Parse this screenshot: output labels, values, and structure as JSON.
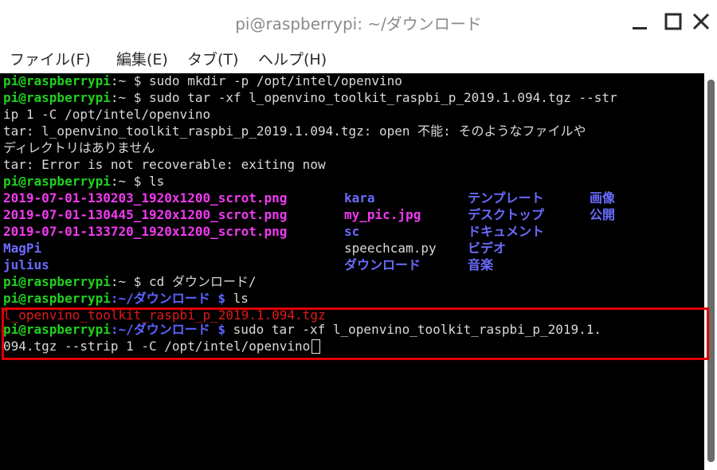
{
  "window": {
    "title": "pi@raspberrypi: ~/ダウンロード",
    "controls": [
      "minimize-icon",
      "maximize-icon",
      "close-icon"
    ]
  },
  "menu": {
    "file": "ファイル(F)",
    "edit": "編集(E)",
    "tabs": "タブ(T)",
    "help": "ヘルプ(H)"
  },
  "terminal": {
    "prompt_user": "pi@raspberrypi",
    "prompt_home": ":~ $ ",
    "prompt_dl_path": ":~/ダウンロード $ ",
    "l1_cmd": "sudo mkdir -p /opt/intel/openvino",
    "l2_cmd": "sudo tar -xf l_openvino_toolkit_raspbi_p_2019.1.094.tgz --str",
    "l3": "ip 1 -C /opt/intel/openvino",
    "l4": "tar: l_openvino_toolkit_raspbi_p_2019.1.094.tgz: open 不能: そのようなファイルや",
    "l5": "ディレクトリはありません",
    "l6": "tar: Error is not recoverable: exiting now",
    "l7_cmd": "ls",
    "ls": {
      "c1": [
        "2019-07-01-130203_1920x1200_scrot.png",
        "2019-07-01-130445_1920x1200_scrot.png",
        "2019-07-01-133720_1920x1200_scrot.png",
        "MagPi",
        "julius"
      ],
      "c2": [
        "kara",
        "my_pic.jpg",
        "sc",
        "speechcam.py",
        "ダウンロード"
      ],
      "c3": [
        "テンプレート",
        "デスクトップ",
        "ドキュメント",
        "ビデオ",
        "音楽"
      ],
      "c4": [
        "画像",
        "公開"
      ]
    },
    "l13_cmd": "cd ダウンロード/",
    "l14_cmd": "ls",
    "l15": "l_openvino_toolkit_raspbi_p_2019.1.094.tgz",
    "l16_cmd": "sudo tar -xf l_openvino_toolkit_raspbi_p_2019.1.",
    "l17": "094.tgz --strip 1 -C /opt/intel/openvino"
  },
  "colors": {
    "prompt_user": "#1fd11f",
    "prompt_path": "#5a63ff",
    "image_files": "#f13af1",
    "directories": "#6b6bff",
    "archive": "#e11a1a",
    "highlight_box": "#e00000"
  }
}
